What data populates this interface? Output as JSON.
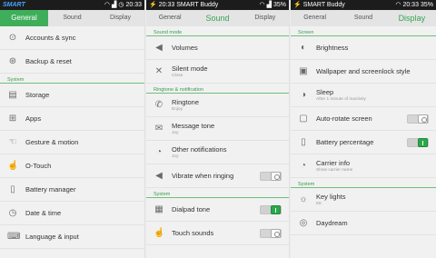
{
  "status": {
    "p1": {
      "carrier": "SMART",
      "time": "20:33"
    },
    "p2": {
      "carrier": "SMART Buddy",
      "time": "20:33",
      "battery": "35%"
    },
    "p3": {
      "carrier": "SMART Buddy",
      "time": "20:33",
      "battery": "35%"
    }
  },
  "tabs": [
    "General",
    "Sound",
    "Display"
  ],
  "panel_general": {
    "rows_top": [
      {
        "label": "Accounts & sync",
        "icon": "accounts-sync-icon",
        "glyph": "⊙"
      },
      {
        "label": "Backup & reset",
        "icon": "backup-icon",
        "glyph": "⊛"
      }
    ],
    "section": "System",
    "rows": [
      {
        "label": "Storage",
        "icon": "storage-icon",
        "glyph": "▤"
      },
      {
        "label": "Apps",
        "icon": "apps-icon",
        "glyph": "⊞"
      },
      {
        "label": "Gesture & motion",
        "icon": "gesture-icon",
        "glyph": "☜"
      },
      {
        "label": "O-Touch",
        "icon": "o-touch-icon",
        "glyph": "☝"
      },
      {
        "label": "Battery manager",
        "icon": "battery-icon",
        "glyph": "▯"
      },
      {
        "label": "Date & time",
        "icon": "clock-icon",
        "glyph": "◷"
      },
      {
        "label": "Language & input",
        "icon": "language-icon",
        "glyph": "⌨"
      }
    ]
  },
  "panel_sound": {
    "section1": "Sound mode",
    "rows1": [
      {
        "label": "Volumes",
        "sub": "",
        "icon": "volume-icon",
        "glyph": "◀"
      },
      {
        "label": "Silent mode",
        "sub": "Close",
        "icon": "silent-icon",
        "glyph": "✕"
      }
    ],
    "section2": "Ringtone & notification",
    "rows2": [
      {
        "label": "Ringtone",
        "sub": "Enjoy",
        "icon": "ringtone-icon",
        "glyph": "✆"
      },
      {
        "label": "Message tone",
        "sub": "Joy",
        "icon": "message-icon",
        "glyph": "✉"
      },
      {
        "label": "Other notifications",
        "sub": "Joy",
        "icon": "notification-icon",
        "glyph": "◔"
      },
      {
        "label": "Vibrate when ringing",
        "sub": "",
        "icon": "vibrate-icon",
        "glyph": "◀",
        "toggle": false
      }
    ],
    "section3": "System",
    "rows3": [
      {
        "label": "Dialpad tone",
        "sub": "",
        "icon": "dialpad-icon",
        "glyph": "▦",
        "toggle": true
      },
      {
        "label": "Touch sounds",
        "sub": "",
        "icon": "touch-icon",
        "glyph": "☝",
        "toggle": false
      }
    ]
  },
  "panel_display": {
    "section1": "Screen",
    "rows1": [
      {
        "label": "Brightness",
        "sub": "",
        "icon": "brightness-icon",
        "glyph": "◐"
      },
      {
        "label": "Wallpaper and screenlock style",
        "sub": "",
        "icon": "wallpaper-icon",
        "glyph": "▣"
      },
      {
        "label": "Sleep",
        "sub": "After 1 minute of inactivity",
        "icon": "sleep-icon",
        "glyph": "◑"
      },
      {
        "label": "Auto-rotate screen",
        "sub": "",
        "icon": "rotate-icon",
        "glyph": "▢",
        "toggle": false
      },
      {
        "label": "Battery percentage",
        "sub": "",
        "icon": "battery-percentage-icon",
        "glyph": "▯",
        "toggle": true
      },
      {
        "label": "Carrier info",
        "sub": "Show carrier name",
        "icon": "carrier-icon",
        "glyph": "◔"
      }
    ],
    "section2": "System",
    "rows2": [
      {
        "label": "Key lights",
        "sub": "6S",
        "icon": "key-lights-icon",
        "glyph": "☼"
      },
      {
        "label": "Daydream",
        "sub": "",
        "icon": "daydream-icon",
        "glyph": "◎"
      }
    ]
  }
}
